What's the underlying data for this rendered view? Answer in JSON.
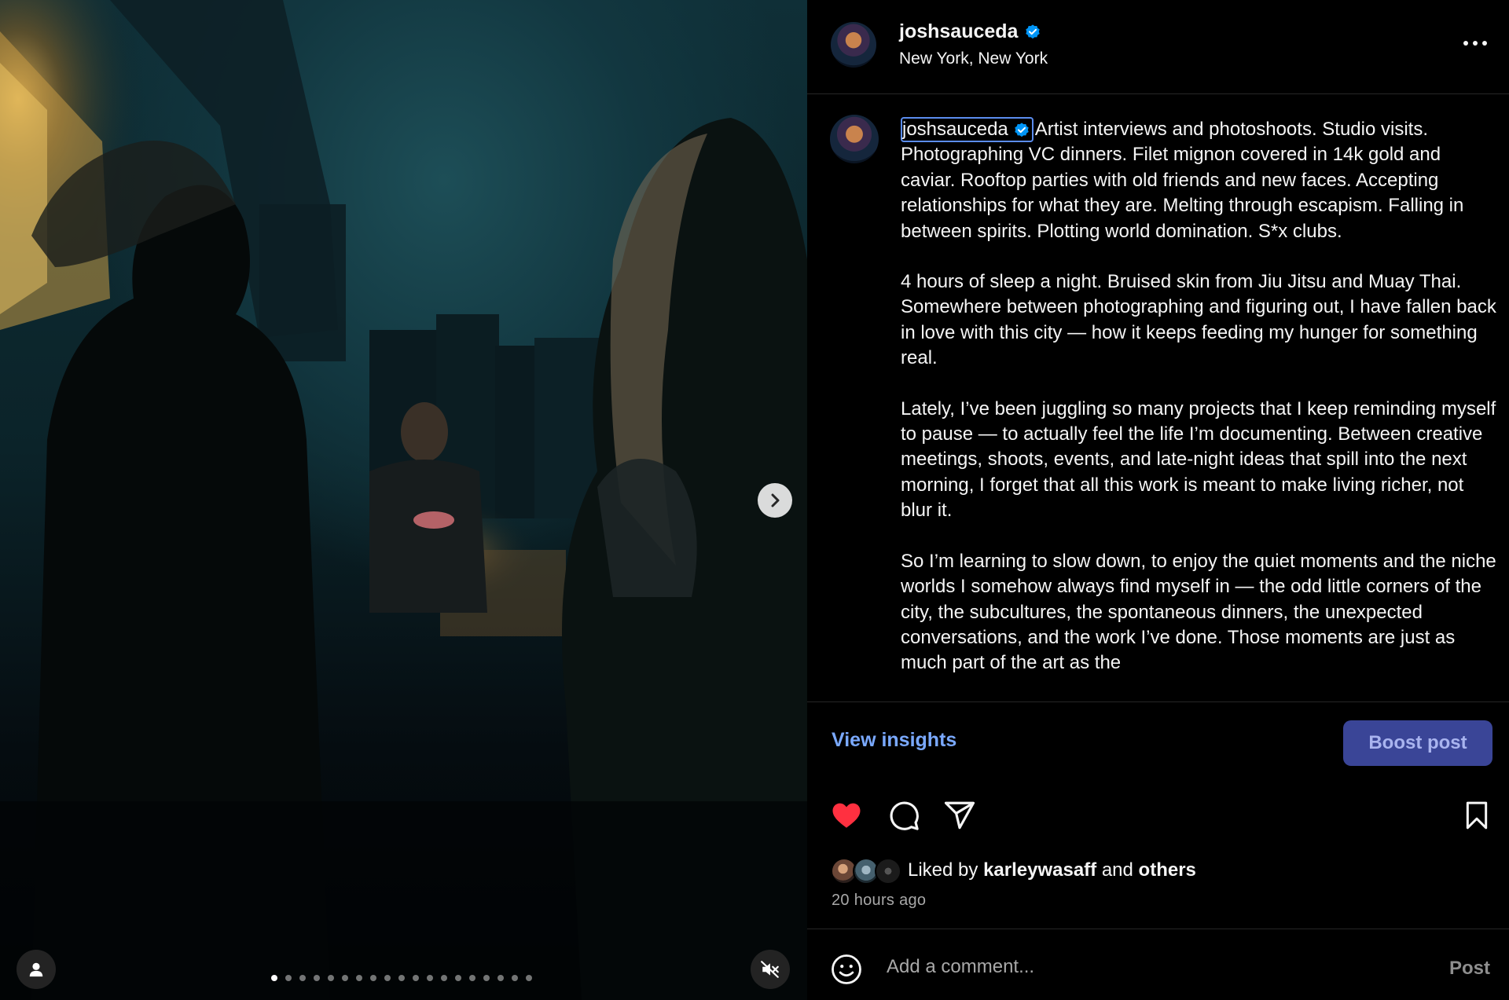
{
  "post": {
    "username": "joshsauceda",
    "location": "New York, New York",
    "verified": true
  },
  "media": {
    "carousel_count": 19,
    "active_index": 0,
    "next_icon": "chevron-right-icon",
    "tag_icon": "person-icon",
    "mute_icon": "speaker-muted-icon"
  },
  "caption": {
    "username": "joshsauceda",
    "paragraphs": [
      "Artist interviews and photoshoots. Studio visits. Photographing VC dinners. Filet mignon covered in 14k gold and caviar. Rooftop parties with old friends and new faces. Accepting relationships for what they are. Melting through escapism. Falling in between spirits. Plotting world domination. S*x clubs.",
      "4 hours of sleep a night. Bruised skin from Jiu Jitsu and Muay Thai. Somewhere between photographing and figuring out, I have fallen back in love with this city — how it keeps feeding my hunger for something real.",
      "Lately, I’ve been juggling so many projects that I keep reminding myself to pause — to actually feel the life I’m documenting. Between creative meetings, shoots, events, and late-night ideas that spill into the next morning, I forget that all this work is meant to make living richer, not blur it.",
      "So I’m learning to slow down, to enjoy the quiet moments and the niche worlds I somehow always find myself in — the odd little corners of the city, the subcultures, the spontaneous dinners, the unexpected conversations, and the work I’ve done. Those moments are just as much part of the art as the"
    ]
  },
  "insights": {
    "view_label": "View insights",
    "boost_label": "Boost post"
  },
  "actions": {
    "liked": true,
    "icons": [
      "heart-filled-icon",
      "comment-icon",
      "send-icon",
      "bookmark-icon"
    ]
  },
  "likes": {
    "prefix": "Liked by",
    "first_user": "karleywasaff",
    "joiner": "and",
    "others": "others"
  },
  "timestamp": "20 hours ago",
  "comment": {
    "placeholder": "Add a comment...",
    "post_label": "Post"
  },
  "colors": {
    "accent_blue": "#7aa9ff",
    "boost_bg": "#3a4597",
    "like_red": "#ff3040",
    "verified_blue": "#0095f6"
  }
}
